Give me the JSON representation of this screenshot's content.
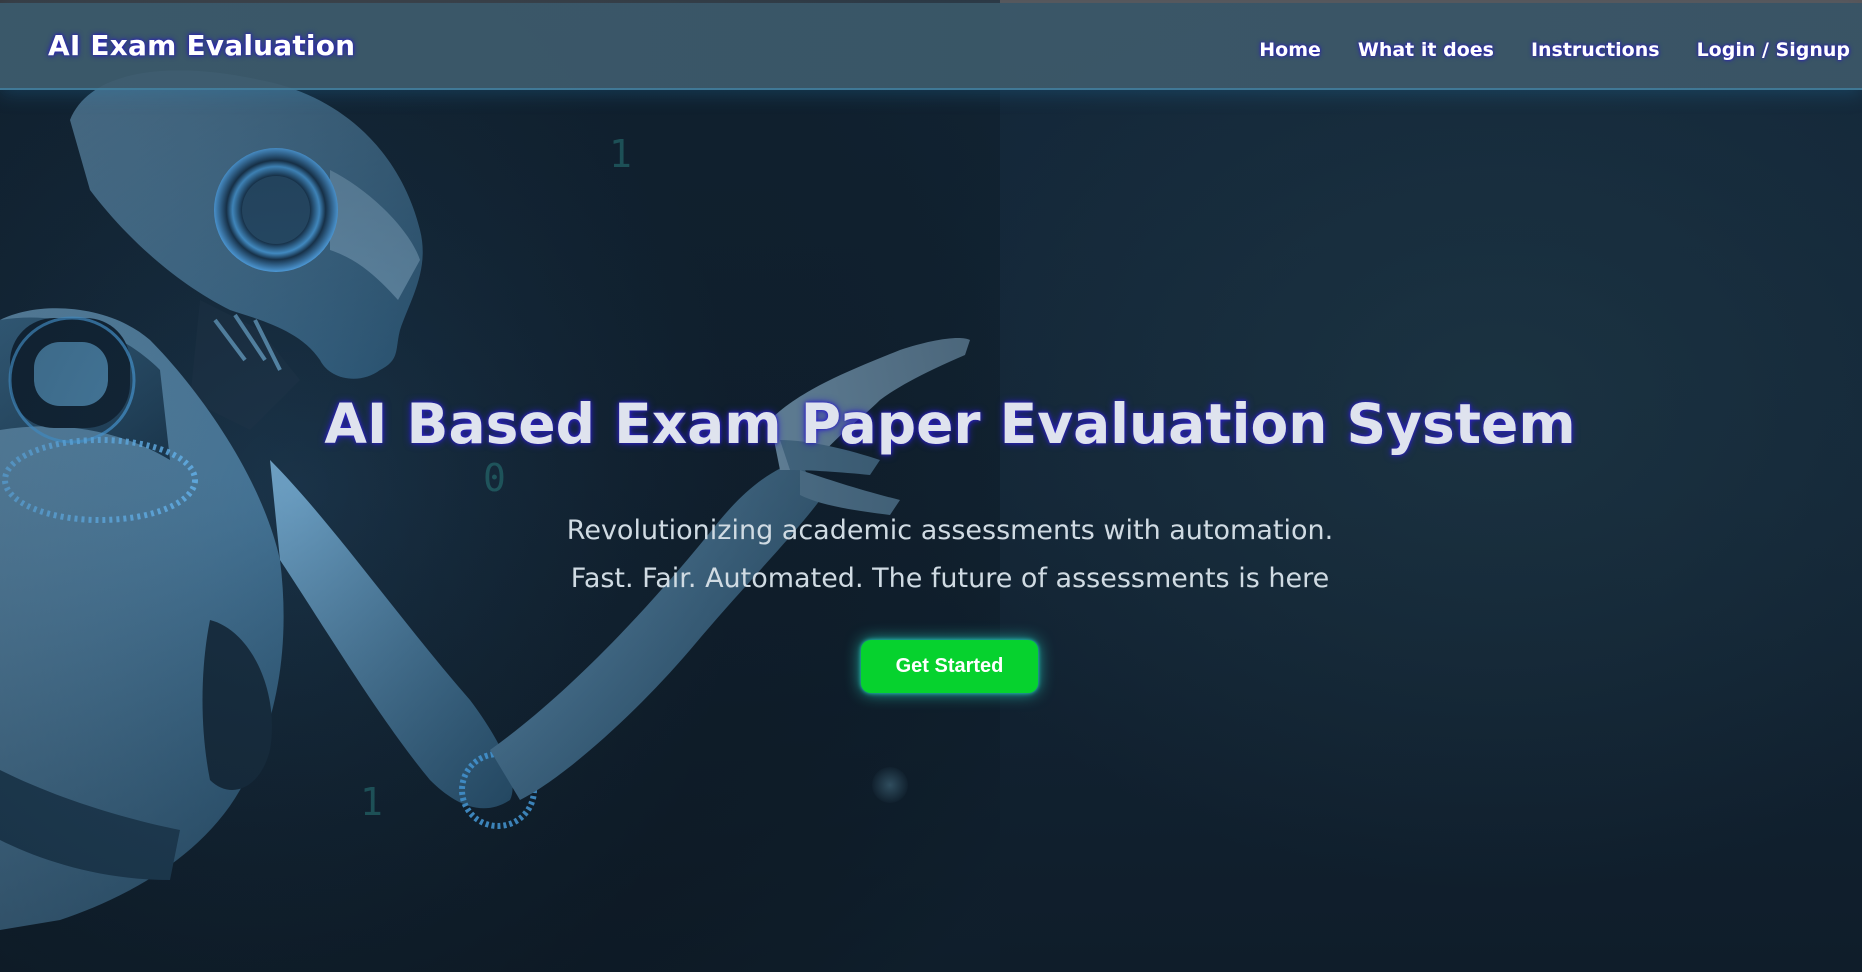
{
  "brand": {
    "title": "AI Exam Evaluation"
  },
  "nav": {
    "items": [
      {
        "label": "Home"
      },
      {
        "label": "What it does"
      },
      {
        "label": "Instructions"
      },
      {
        "label": "Login / Signup"
      }
    ]
  },
  "hero": {
    "title": "AI Based Exam Paper Evaluation System",
    "subtitle_line1": "Revolutionizing academic assessments with automation.",
    "subtitle_line2": "Fast. Fair. Automated. The future of assessments is here",
    "cta_label": "Get Started"
  },
  "decor": {
    "digits": [
      "1",
      "0",
      "1"
    ]
  },
  "colors": {
    "navbar": "#3e5c6e",
    "background": "#132536",
    "cta": "#06d22e",
    "title_glow": "#2d20c8"
  }
}
